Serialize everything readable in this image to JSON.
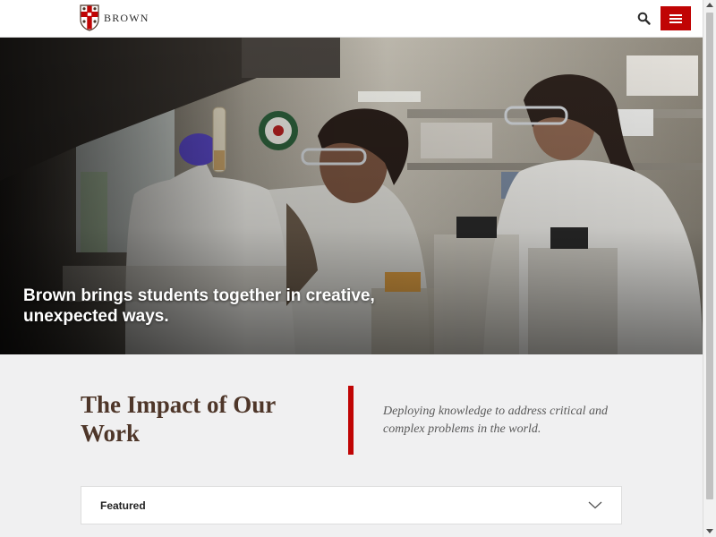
{
  "header": {
    "brand_name": "BROWN",
    "logo_icon": "brown-shield-icon",
    "search_icon": "search-icon",
    "menu_icon": "hamburger-menu-icon"
  },
  "hero": {
    "caption": "Brown brings students together in creative, unexpected ways."
  },
  "impact": {
    "title": "The Impact of Our Work",
    "description": "Deploying knowledge to address critical and complex problems in the world."
  },
  "featured": {
    "label": "Featured",
    "toggle_icon": "chevron-down-icon"
  },
  "colors": {
    "brand_red": "#c00404",
    "brand_brown": "#4e3629",
    "page_background": "#f0f0f1"
  }
}
